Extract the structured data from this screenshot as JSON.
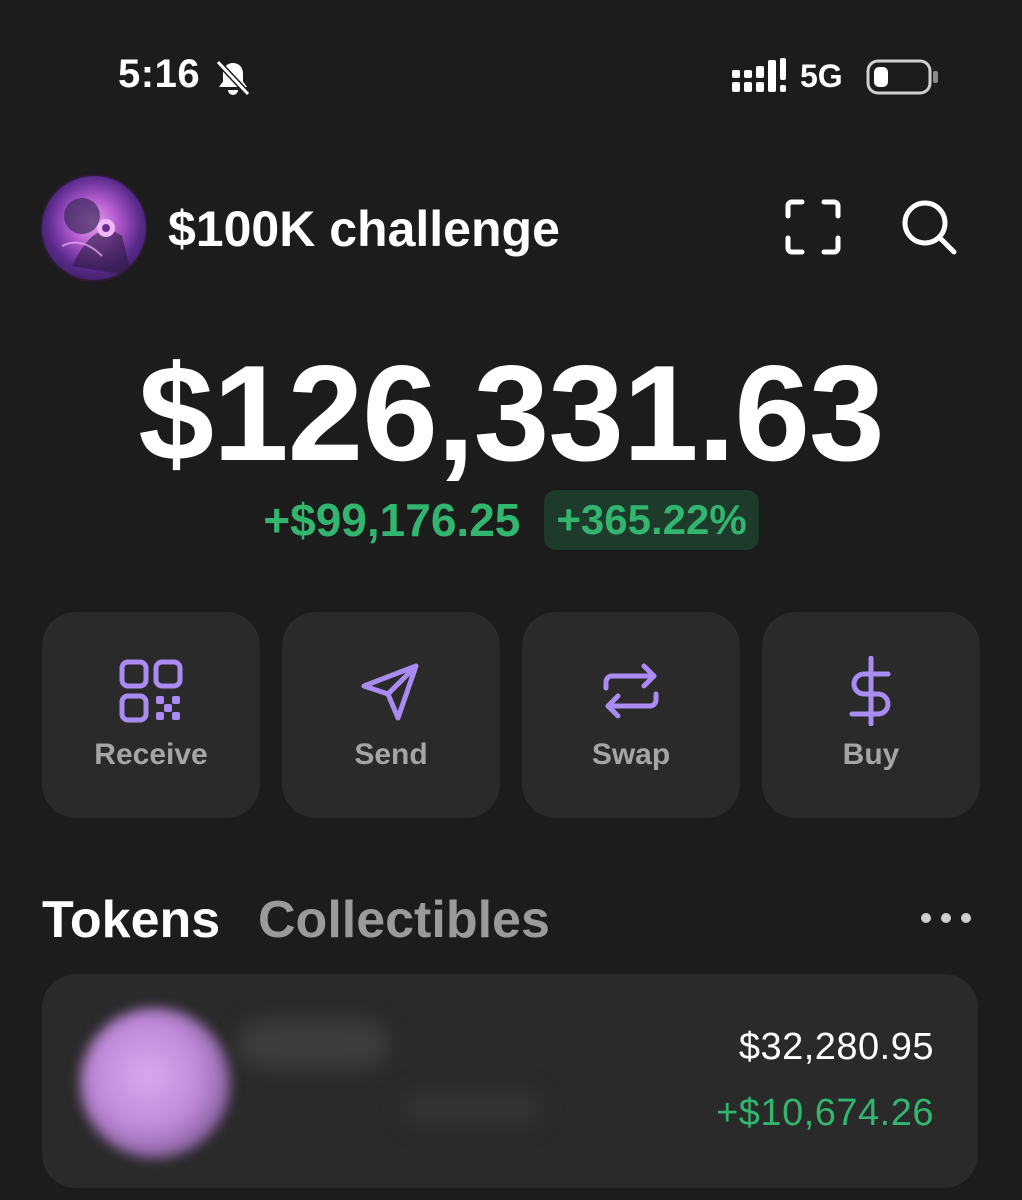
{
  "status_bar": {
    "time": "5:16",
    "network": "5G",
    "icons": [
      "bell-slash-icon",
      "signal-icon",
      "battery-icon"
    ]
  },
  "header": {
    "wallet_name": "$100K challenge",
    "icons": [
      "avatar",
      "scan-icon",
      "search-icon"
    ]
  },
  "balance": {
    "total": "$126,331.63",
    "change_amount": "+$99,176.25",
    "change_percent": "+365.22%"
  },
  "actions": [
    {
      "label": "Receive",
      "icon": "qr-code-icon"
    },
    {
      "label": "Send",
      "icon": "paper-plane-icon"
    },
    {
      "label": "Swap",
      "icon": "swap-arrows-icon"
    },
    {
      "label": "Buy",
      "icon": "dollar-icon"
    }
  ],
  "tabs": {
    "tokens": "Tokens",
    "collectibles": "Collectibles",
    "active": "Tokens"
  },
  "tokens": [
    {
      "value": "$32,280.95",
      "change": "+$10,674.26"
    }
  ],
  "colors": {
    "background": "#1c1c1c",
    "card": "#2a2a2a",
    "accent_purple": "#a98bf2",
    "positive_green": "#32b56e",
    "positive_bg": "#1d3a2a",
    "muted_text": "#a5a5a5"
  }
}
